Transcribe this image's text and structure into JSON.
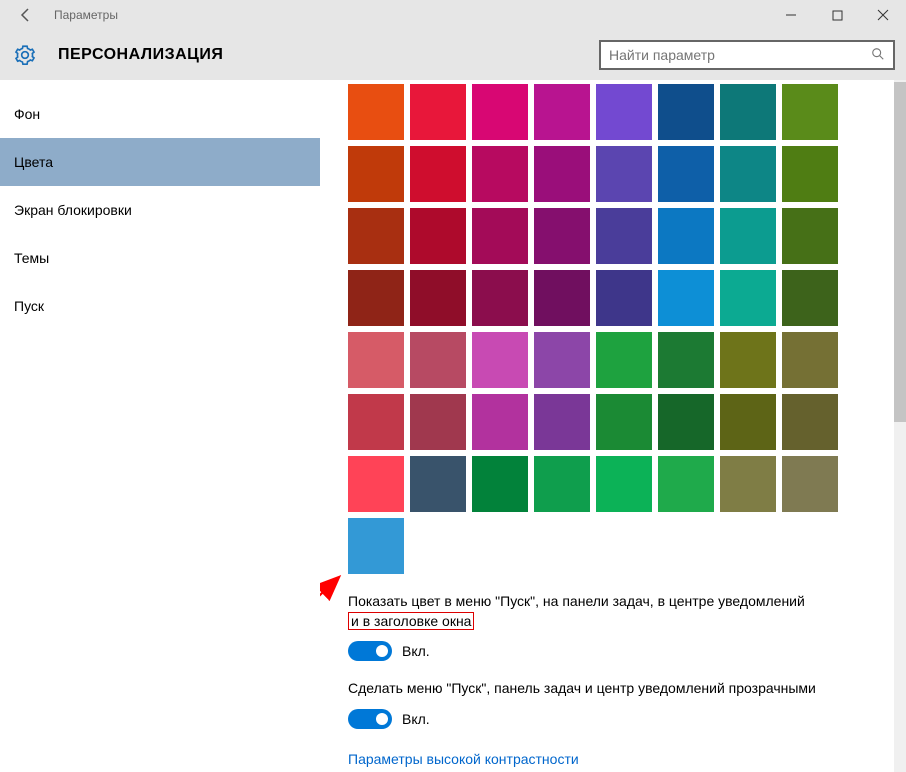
{
  "window": {
    "title": "Параметры"
  },
  "header": {
    "page_title": "ПЕРСОНАЛИЗАЦИЯ",
    "search_placeholder": "Найти параметр"
  },
  "sidebar": {
    "items": [
      {
        "label": "Фон"
      },
      {
        "label": "Цвета"
      },
      {
        "label": "Экран блокировки"
      },
      {
        "label": "Темы"
      },
      {
        "label": "Пуск"
      }
    ],
    "active_index": 1
  },
  "color_grid": {
    "rows": [
      [
        "#e84e11",
        "#e8173a",
        "#d80773",
        "#b81490",
        "#7349d1",
        "#0f4e8c",
        "#0d7878",
        "#5a8b1a"
      ],
      [
        "#c03a0a",
        "#cf0d2e",
        "#b70a60",
        "#9a0e7a",
        "#5b45b0",
        "#0e5fa8",
        "#0d8686",
        "#4f7d13"
      ],
      [
        "#a82f11",
        "#ae0a2c",
        "#a30b58",
        "#850f6e",
        "#4a3d9a",
        "#0c78c2",
        "#0c9c90",
        "#467017"
      ],
      [
        "#8f2417",
        "#8f0d29",
        "#8b0d4d",
        "#700f5f",
        "#3e368a",
        "#0d8fd6",
        "#0caa92",
        "#3d631b"
      ],
      [
        "#d65b67",
        "#b74a63",
        "#c84ab3",
        "#8c46a8",
        "#1ea23f",
        "#1c7a33",
        "#6e741a",
        "#757034"
      ],
      [
        "#c1394a",
        "#a0384e",
        "#b2329e",
        "#7a3797",
        "#1b8a34",
        "#166729",
        "#5d6416",
        "#65612d"
      ],
      [
        "#ff4357",
        "#39536b",
        "#02823a",
        "#0f9e4d",
        "#0cb257",
        "#1faa4b",
        "#7f7d45",
        "#7f7a52"
      ]
    ],
    "extra_swatch": "#3399d6"
  },
  "settings": {
    "setting1": {
      "text_before": "Показать цвет в меню \"Пуск\", на панели задач, в центре уведомлений",
      "highlighted": " и в заголовке окна",
      "state": "Вкл."
    },
    "setting2": {
      "text": "Сделать меню \"Пуск\", панель задач и центр уведомлений прозрачными",
      "state": "Вкл."
    },
    "link": "Параметры высокой контрастности"
  }
}
